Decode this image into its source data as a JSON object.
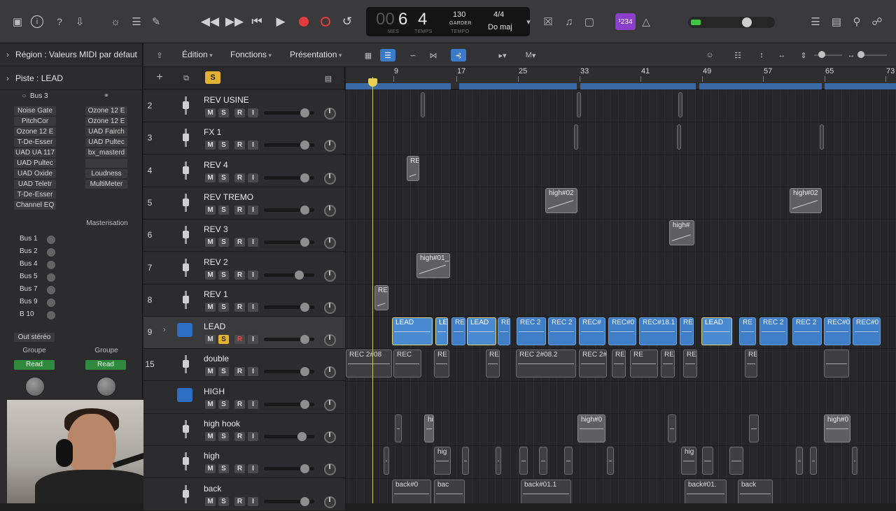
{
  "transport": {
    "bars": "6",
    "bars_prefix": "00",
    "beat": "4",
    "bars_caption": "MES",
    "beat_caption": "TEMPS",
    "tempo": "130",
    "tempo_mode": "GARDER",
    "tempo_caption": "TEMPO",
    "signature": "4/4",
    "key": "Do maj",
    "count_badge": "¹234",
    "record_color": "#e23b3b"
  },
  "inspector": {
    "region_label": "Région :",
    "region_value": "Valeurs MIDI par défaut",
    "track_label": "Piste :",
    "track_value": "LEAD",
    "col1_header": "Bus 3",
    "col1_plugins": [
      "Noise Gate",
      "PitchCor",
      "Ozone 12 E",
      "T-De-Esser",
      "UAD UA 117",
      "UAD Pultec",
      "UAD Oxide",
      "UAD Teletr",
      "T-De-Esser",
      "Channel EQ"
    ],
    "col2_plugins": [
      "Ozone 12 E",
      "Ozone 12 E",
      "UAD Fairch",
      "UAD Pultec",
      "bx_masterd",
      "",
      "Loudness",
      "MultiMeter"
    ],
    "col2_section": "Masterisation",
    "sends": [
      "Bus 1",
      "Bus 2",
      "Bus 4",
      "Bus 5",
      "Bus 7",
      "Bus 9",
      "B 10"
    ],
    "output": "Out stéréo",
    "group1": "Groupe",
    "group2": "Groupe",
    "auto1": "Read",
    "auto2": "Read"
  },
  "menus": {
    "edition": "Édition",
    "fonctions": "Fonctions",
    "presentation": "Présentation",
    "tool_pointer": "▸",
    "tool_marquee": "M"
  },
  "header_top": {
    "add": "+",
    "solo_label": "S"
  },
  "tracks": [
    {
      "num": "2",
      "name": "REV USINE",
      "fader": 0.8
    },
    {
      "num": "3",
      "name": "FX 1",
      "fader": 0.8
    },
    {
      "num": "4",
      "name": "REV 4",
      "fader": 0.8
    },
    {
      "num": "5",
      "name": "REV TREMO",
      "fader": 0.8
    },
    {
      "num": "6",
      "name": "REV 3",
      "fader": 0.8
    },
    {
      "num": "7",
      "name": "REV 2",
      "fader": 0.7
    },
    {
      "num": "8",
      "name": "REV 1",
      "fader": 0.8
    },
    {
      "num": "9",
      "name": "LEAD",
      "fader": 0.8
    },
    {
      "num": "15",
      "name": "double",
      "fader": 0.8
    },
    {
      "num": "",
      "name": "HIGH",
      "fader": 0.8
    },
    {
      "num": "",
      "name": "high hook",
      "fader": 0.75
    },
    {
      "num": "",
      "name": "high",
      "fader": 0.8
    },
    {
      "num": "",
      "name": "back",
      "fader": 0.8
    }
  ],
  "msri": {
    "m": "M",
    "s": "S",
    "r": "R",
    "i": "I"
  },
  "ruler": {
    "labels": [
      "9",
      "17",
      "25",
      "33",
      "41",
      "49",
      "57",
      "65",
      "73"
    ]
  },
  "regions": {
    "rev4": "RE",
    "revtremo1": "high#02",
    "revtremo2": "high#02",
    "rev3": "high#",
    "rev2": "high#01_",
    "rev1": "RE",
    "lead": [
      "LEAD",
      "LE",
      "RE",
      "LEAD",
      "RE",
      "REC 2",
      "REC 2",
      "REC#",
      "REC#0",
      "REC#18.1",
      "RE",
      "LEAD",
      "RE",
      "REC 2",
      "REC 2",
      "REC#0",
      "REC#0"
    ],
    "double": [
      "REC 2#08",
      "REC",
      "RE",
      "REC",
      "REC 2#08.2",
      "REC 2#",
      "REC",
      "RE",
      "RE",
      "RE",
      "REC 2"
    ],
    "highhook": [
      "hi",
      "high#0",
      "high#0"
    ],
    "high": [
      "hig",
      "hig"
    ],
    "back": [
      "back#0",
      "bac",
      "back#01.1",
      "back#01.",
      "back"
    ]
  }
}
